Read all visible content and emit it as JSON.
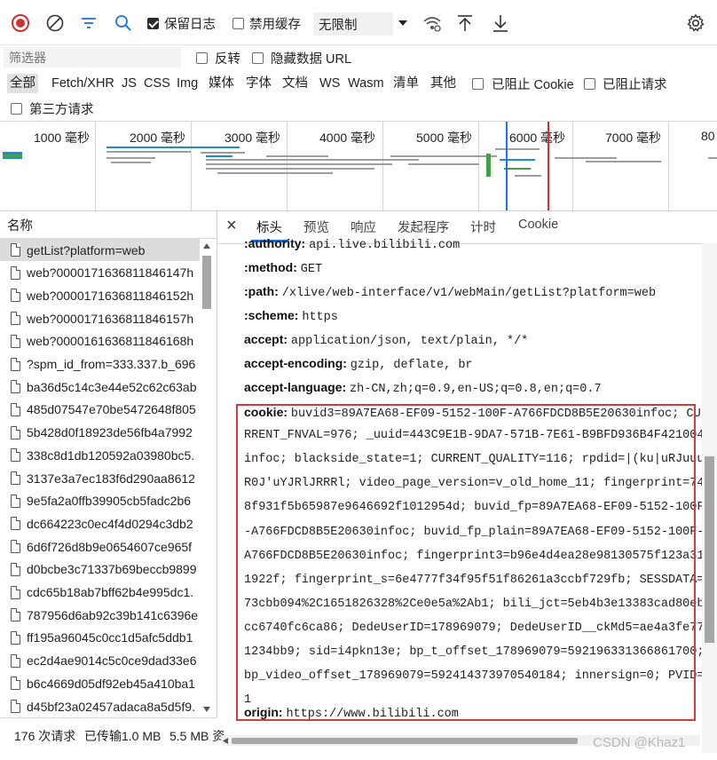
{
  "toolbar": {
    "preserve_log": "保留日志",
    "disable_cache": "禁用缓存",
    "throttle": "无限制"
  },
  "filter": {
    "placeholder": "筛选器",
    "invert": "反转",
    "hide_data_url": "隐藏数据 URL"
  },
  "types": [
    "全部",
    "Fetch/XHR",
    "JS",
    "CSS",
    "Img",
    "媒体",
    "字体",
    "文档",
    "WS",
    "Wasm",
    "清单",
    "其他"
  ],
  "blocked_cookies": "已阻止 Cookie",
  "blocked_requests": "已阻止请求",
  "third_party": "第三方请求",
  "timeline": {
    "ticks": [
      "1000 毫秒",
      "2000 毫秒",
      "3000 毫秒",
      "4000 毫秒",
      "5000 毫秒",
      "6000 毫秒",
      "7000 毫秒",
      "80"
    ]
  },
  "list": {
    "header": "名称",
    "items": [
      "getList?platform=web",
      "web?0000171636811846147h",
      "web?0000171636811846152h",
      "web?0000171636811846157h",
      "web?0000161636811846168h",
      "?spm_id_from=333.337.b_696",
      "ba36d5c14c3e44e52c62c63ab",
      "485d07547e70be5472648f805",
      "5b428d0f18923de56fb4a7992",
      "338c8d1db120592a03980bc5.",
      "3137e3a7ec183f6d290aa8612",
      "9e5fa2a0ffb39905cb5fadc2b6",
      "dc664223c0ec4f4d0294c3db2",
      "6d6f726d8b9e0654607ce965f",
      "d0bcbe3c71337b69beccb9899",
      "cdc65b18ab7bff62b4e995dc1.",
      "787956d6ab92c39b141c6396e",
      "ff195a96045c0cc1d5afc5ddb1",
      "ec2d4ae9014c5c0ce9dad33e6",
      "b6c4669d05df92eb45a410ba1",
      "d45bf23a02457adaca8a5d5f9."
    ]
  },
  "status": {
    "requests": "176 次请求",
    "transferred": "已传输1.0 MB",
    "resources": "5.5 MB 资"
  },
  "tabs": [
    "标头",
    "预览",
    "响应",
    "发起程序",
    "计时",
    "Cookie"
  ],
  "headers": {
    "authority": {
      "name": ":authority:",
      "value": "api.live.bilibili.com"
    },
    "method": {
      "name": ":method:",
      "value": "GET"
    },
    "path": {
      "name": ":path:",
      "value": "/xlive/web-interface/v1/webMain/getList?platform=web"
    },
    "scheme": {
      "name": ":scheme:",
      "value": "https"
    },
    "accept": {
      "name": "accept:",
      "value": "application/json, text/plain, */*"
    },
    "accept_encoding": {
      "name": "accept-encoding:",
      "value": "gzip, deflate, br"
    },
    "accept_language": {
      "name": "accept-language:",
      "value": "zh-CN,zh;q=0.9,en-US;q=0.8,en;q=0.7"
    },
    "cookie_name": "cookie:",
    "cookie_lines": [
      "buvid3=89A7EA68-EF09-5152-100F-A766FDCD8B5E20630infoc; CU",
      "RRENT_FNVAL=976; _uuid=443C9E1B-9DA7-571B-7E61-B9BFD936B4F421004",
      "infoc; blackside_state=1; CURRENT_QUALITY=116; rpdid=|(ku|uRJuuu",
      "R0J'uYJRlJRRRl; video_page_version=v_old_home_11; fingerprint=74",
      "8f931f5b65987e9646692f1012954d; buvid_fp=89A7EA68-EF09-5152-100F",
      "-A766FDCD8B5E20630infoc; buvid_fp_plain=89A7EA68-EF09-5152-100F-",
      "A766FDCD8B5E20630infoc; fingerprint3=b96e4d4ea28e98130575f123a31",
      "1922f; fingerprint_s=6e4777f34f95f51f86261a3ccbf729fb; SESSDATA=",
      "73cbb094%2C1651826328%2Ce0e5a%2Ab1; bili_jct=5eb4b3e13383cad80eb",
      "cc6740fc6ca86; DedeUserID=178969079; DedeUserID__ckMd5=ae4a3fe77",
      "1234bb9; sid=i4pkn13e; bp_t_offset_178969079=592196331366861700;",
      "bp_video_offset_178969079=592414373970540184; innersign=0; PVID=",
      "1"
    ],
    "origin": {
      "name": "origin:",
      "value": "https://www.bilibili.com"
    }
  },
  "watermark": "CSDN @Khaz1"
}
